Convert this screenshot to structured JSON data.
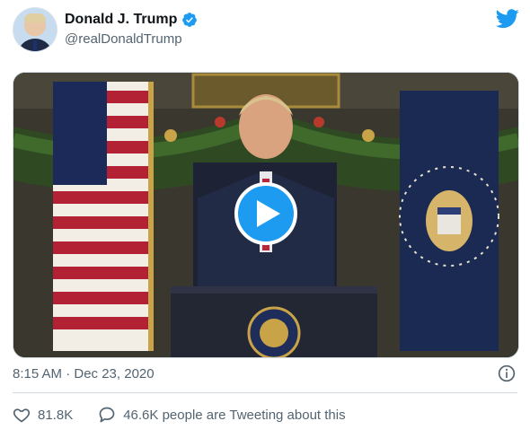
{
  "author": {
    "display_name": "Donald J. Trump",
    "handle": "@realDonaldTrump"
  },
  "icons": {
    "verified": "verified-badge-icon",
    "brand": "twitter-bird-icon",
    "play": "play-icon",
    "info": "info-icon",
    "like": "heart-icon",
    "reply": "speech-bubble-icon"
  },
  "colors": {
    "brand_blue": "#1d9bf0",
    "secondary_text": "#536471",
    "primary_text": "#0f1419"
  },
  "tweet": {
    "timestamp": "8:15 AM · Dec 23, 2020"
  },
  "stats": {
    "likes": "81.8K",
    "tweeting": "46.6K people are Tweeting about this"
  }
}
